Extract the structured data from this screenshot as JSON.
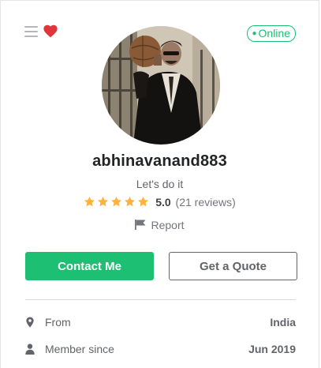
{
  "status": {
    "online_label": "Online",
    "accent": "#1dbf73"
  },
  "profile": {
    "username": "abhinavanand883",
    "tagline": "Let's do it",
    "rating": {
      "stars": 5,
      "score": "5.0",
      "reviews": "(21 reviews)",
      "star_color": "#ffb33e"
    },
    "report_label": "Report"
  },
  "actions": {
    "contact_label": "Contact Me",
    "quote_label": "Get a Quote"
  },
  "stats": {
    "from_label": "From",
    "from_value": "India",
    "member_label": "Member since",
    "member_value": "Jun 2019"
  },
  "icons": {
    "menu": "menu-icon",
    "favorite": "heart-icon",
    "report": "flag-icon",
    "location": "location-pin-icon",
    "member": "user-icon"
  }
}
